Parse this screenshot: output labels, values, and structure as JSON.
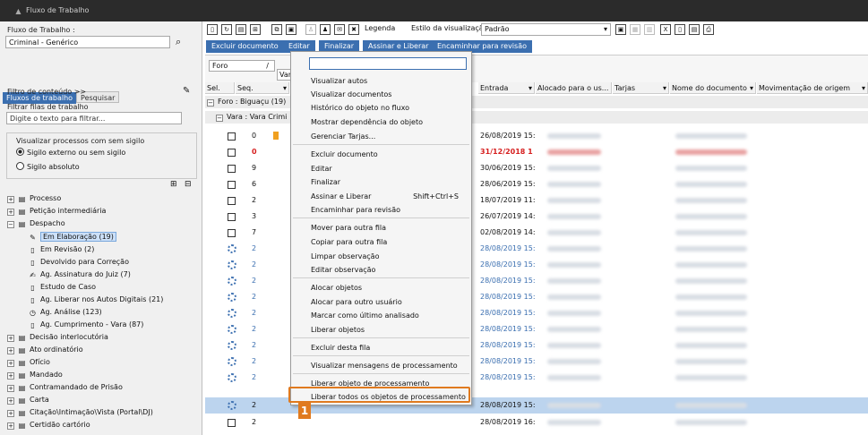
{
  "window": {
    "title": "Fluxo de Trabalho"
  },
  "left": {
    "flow_label": "Fluxo de Trabalho :",
    "flow_value": "Criminal - Genérico",
    "tabs": [
      {
        "label": "Fluxos de trabalho"
      },
      {
        "label": "Pesquisar"
      }
    ],
    "content_filter": "Filtro de conteúdo >>",
    "filter_label": "Filtrar filas de trabalho",
    "filter_placeholder": "Digite o texto para filtrar...",
    "visualize_label": "Visualizar processos com sem sigilo",
    "radio1": "Sigilo externo ou sem sigilo",
    "radio2": "Sigilo absoluto",
    "tree": [
      {
        "label": "Processo"
      },
      {
        "label": "Petição intermediária"
      },
      {
        "label": "Despacho"
      },
      {
        "label": "Em Elaboração (19)"
      },
      {
        "label": "Em Revisão (2)"
      },
      {
        "label": "Devolvido para Correção"
      },
      {
        "label": "Ag. Assinatura do Juiz (7)"
      },
      {
        "label": "Estudo de Caso"
      },
      {
        "label": "Ag. Liberar nos Autos Digitais (21)"
      },
      {
        "label": "Ag. Análise (123)"
      },
      {
        "label": "Ag. Cumprimento - Vara (87)"
      },
      {
        "label": "Decisão interlocutória"
      },
      {
        "label": "Ato ordinatório"
      },
      {
        "label": "Ofício"
      },
      {
        "label": "Mandado"
      },
      {
        "label": "Contramandado de Prisão"
      },
      {
        "label": "Carta"
      },
      {
        "label": "Citação\\Intimação\\Vista (Portal\\DJ)"
      },
      {
        "label": "Certidão cartório"
      }
    ]
  },
  "toolbar": {
    "legend": "Legenda",
    "style_label": "Estilo da visualização",
    "style_value": "Padrão",
    "actions": [
      "Excluir documento",
      "Editar",
      "Finalizar",
      "Assinar e Liberar",
      "Encaminhar para revisão"
    ]
  },
  "grid": {
    "group_field": "Foro",
    "group_field2": "Vara",
    "headers": [
      "Sel.",
      "Seq.",
      "Entrada",
      "Alocado para o us...",
      "Tarjas",
      "Nome do documento",
      "Movimentação de origem"
    ],
    "group1": "Foro : Biguaçu  (19)",
    "group2": "Vara : Vara Crimi",
    "rows": [
      {
        "seq": "0",
        "date": "26/08/2019 15:"
      },
      {
        "seq": "0",
        "date": "31/12/2018 1"
      },
      {
        "seq": "9",
        "date": "30/06/2019 15:"
      },
      {
        "seq": "6",
        "date": "28/06/2019 15:"
      },
      {
        "seq": "2",
        "date": "18/07/2019 11:"
      },
      {
        "seq": "3",
        "date": "26/07/2019 14:"
      },
      {
        "seq": "7",
        "date": "02/08/2019 14:"
      },
      {
        "seq": "2",
        "date": "28/08/2019 15:"
      },
      {
        "seq": "2",
        "date": "28/08/2019 15:"
      },
      {
        "seq": "2",
        "date": "28/08/2019 15:"
      },
      {
        "seq": "2",
        "date": "28/08/2019 15:"
      },
      {
        "seq": "2",
        "date": "28/08/2019 15:"
      },
      {
        "seq": "2",
        "date": "28/08/2019 15:"
      },
      {
        "seq": "2",
        "date": "28/08/2019 15:"
      },
      {
        "seq": "2",
        "date": "28/08/2019 15:"
      },
      {
        "seq": "2",
        "date": "28/08/2019 15:"
      },
      {
        "seq": "2",
        "date": "28/08/2019 15:"
      },
      {
        "seq": "2",
        "date": "28/08/2019 16:"
      }
    ]
  },
  "menu": {
    "items": [
      "Visualizar autos",
      "Visualizar documentos",
      "Histórico do objeto no fluxo",
      "Mostrar dependência do objeto",
      "Gerenciar Tarjas...",
      "Excluir documento",
      "Editar",
      "Finalizar",
      "Assinar e Liberar",
      "Encaminhar para revisão",
      "Mover para outra fila",
      "Copiar para outra fila",
      "Limpar observação",
      "Editar observação",
      "Alocar objetos",
      "Alocar para outro usuário",
      "Marcar como último analisado",
      "Liberar objetos",
      "Excluir desta fila",
      "Visualizar mensagens de processamento",
      "Liberar objeto de processamento",
      "Liberar todos os objetos de processamento"
    ],
    "shortcut": "Shift+Ctrl+S"
  },
  "annotation": {
    "number": "1"
  },
  "colors": {
    "accent": "#3b6fb0",
    "highlight": "#e07a1f",
    "red": "#d62020"
  }
}
